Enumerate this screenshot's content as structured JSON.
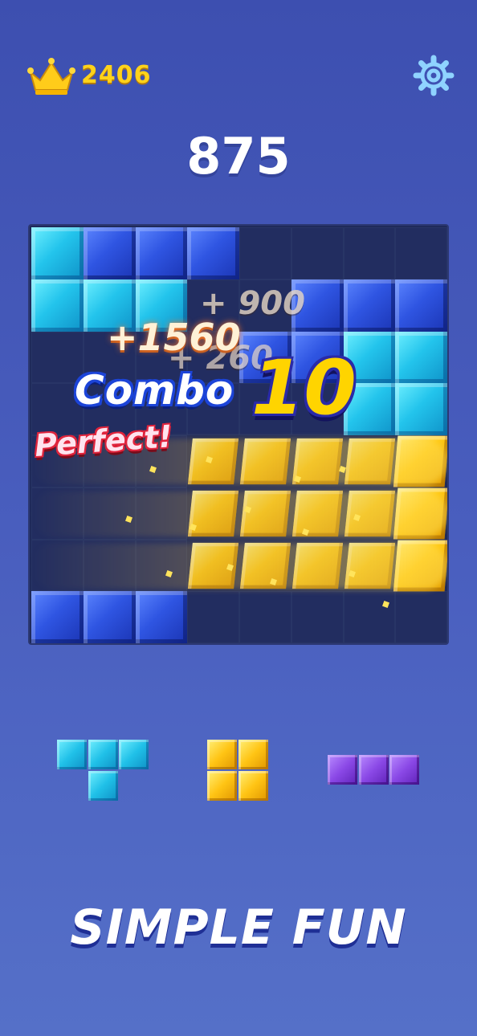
{
  "header": {
    "best_score": "2406",
    "best_icon": "crown-icon",
    "settings_icon": "gear-icon"
  },
  "score": "875",
  "board": {
    "size": 8,
    "rows": [
      [
        "cyan",
        "blue",
        "blue",
        "blue",
        "",
        "",
        "",
        ""
      ],
      [
        "cyan",
        "cyan",
        "cyan",
        "",
        "",
        "blue",
        "blue",
        "blue"
      ],
      [
        "",
        "",
        "",
        "",
        "blue",
        "blue",
        "cyan",
        "cyan"
      ],
      [
        "",
        "",
        "",
        "",
        "",
        "",
        "cyan",
        "cyan"
      ],
      [
        "",
        "",
        "",
        "gold",
        "gold",
        "gold",
        "gold",
        "gold-solid"
      ],
      [
        "",
        "",
        "",
        "gold",
        "gold",
        "gold",
        "gold",
        "gold-solid"
      ],
      [
        "",
        "",
        "",
        "gold",
        "gold",
        "gold",
        "gold",
        "gold-solid"
      ],
      [
        "blue",
        "blue",
        "blue",
        "",
        "",
        "",
        "",
        ""
      ]
    ],
    "colors": {
      "cyan": "#23c4ec",
      "blue": "#2f55e2",
      "gold": "#ffc914",
      "empty": "#222d60"
    }
  },
  "effects": {
    "points_900": "+ 900",
    "points_1560": "+1560",
    "points_260": "+ 260",
    "combo_word": "Combo",
    "combo_count": "10",
    "perfect": "Perfect!"
  },
  "pieces": [
    {
      "name": "t-piece",
      "color": "cyan",
      "cells": [
        [
          0,
          0
        ],
        [
          0,
          1
        ],
        [
          0,
          2
        ],
        [
          1,
          1
        ]
      ]
    },
    {
      "name": "square-piece",
      "color": "gold",
      "cells": [
        [
          0,
          0
        ],
        [
          0,
          1
        ],
        [
          1,
          0
        ],
        [
          1,
          1
        ]
      ]
    },
    {
      "name": "line-piece",
      "color": "purple",
      "cells": [
        [
          0,
          0
        ],
        [
          0,
          1
        ],
        [
          0,
          2
        ]
      ]
    }
  ],
  "tagline": "SIMPLE FUN"
}
